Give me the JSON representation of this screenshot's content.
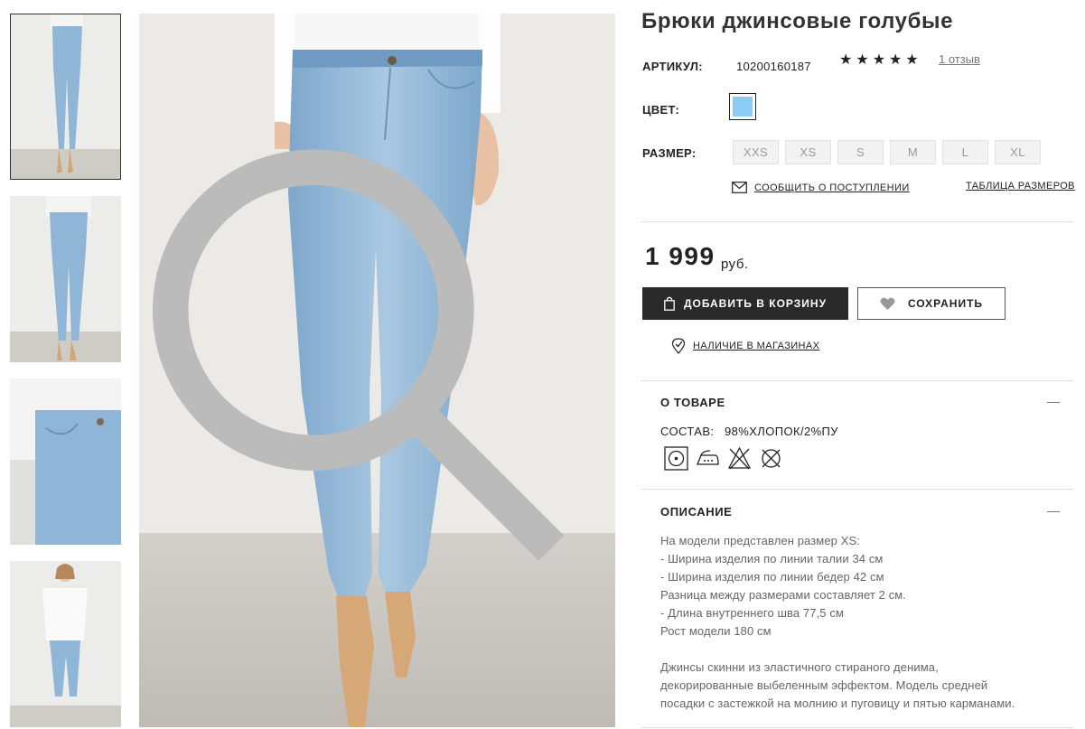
{
  "product": {
    "title": "Брюки джинсовые голубые",
    "sku_label": "АРТИКУЛ:",
    "sku_value": "10200160187",
    "rating_stars": "★★★★★",
    "reviews_link": "1 отзыв",
    "color_label": "ЦВЕТ:",
    "color_value": "#8ccbf4",
    "size_label": "РАЗМЕР:",
    "sizes": [
      "XXS",
      "XS",
      "S",
      "M",
      "L",
      "XL"
    ],
    "notify_link": "СООБЩИТЬ О ПОСТУПЛЕНИИ",
    "size_table_link": "ТАБЛИЦА РАЗМЕРОВ",
    "price": "1 999",
    "currency": "руб.",
    "add_to_cart": "ДОБАВИТЬ В КОРЗИНУ",
    "save": "СОХРАНИТЬ",
    "stores_link": "НАЛИЧИЕ В МАГАЗИНАХ"
  },
  "about": {
    "title": "О ТОВАРЕ",
    "composition_label": "СОСТАВ:",
    "composition_value": "98%ХЛОПОК/2%ПУ",
    "care_icons": [
      "wash-30-icon",
      "iron-low-icon",
      "no-bleach-icon",
      "no-dry-clean-icon"
    ]
  },
  "description": {
    "title": "ОПИСАНИЕ",
    "lines": [
      "На модели представлен размер XS:",
      "- Ширина изделия по линии талии 34 см",
      "- Ширина изделия по линии бедер 42 см",
      "Разница между размерами составляет 2 см.",
      "- Длина внутреннего шва 77,5 см",
      "Рост модели 180 см"
    ],
    "paragraph": [
      "Джинсы скинни из эластичного стираного денима,",
      "декорированные выбеленным эффектом. Модель средней",
      "посадки с застежкой на молнию и пуговицу и пятью карманами."
    ]
  },
  "gallery": {
    "thumbnails": [
      "front-view",
      "back-view",
      "pocket-detail",
      "full-look"
    ],
    "active_index": 0
  },
  "colors": {
    "accent_dark": "#2a2a2a",
    "denim": "#8fb6d6"
  }
}
